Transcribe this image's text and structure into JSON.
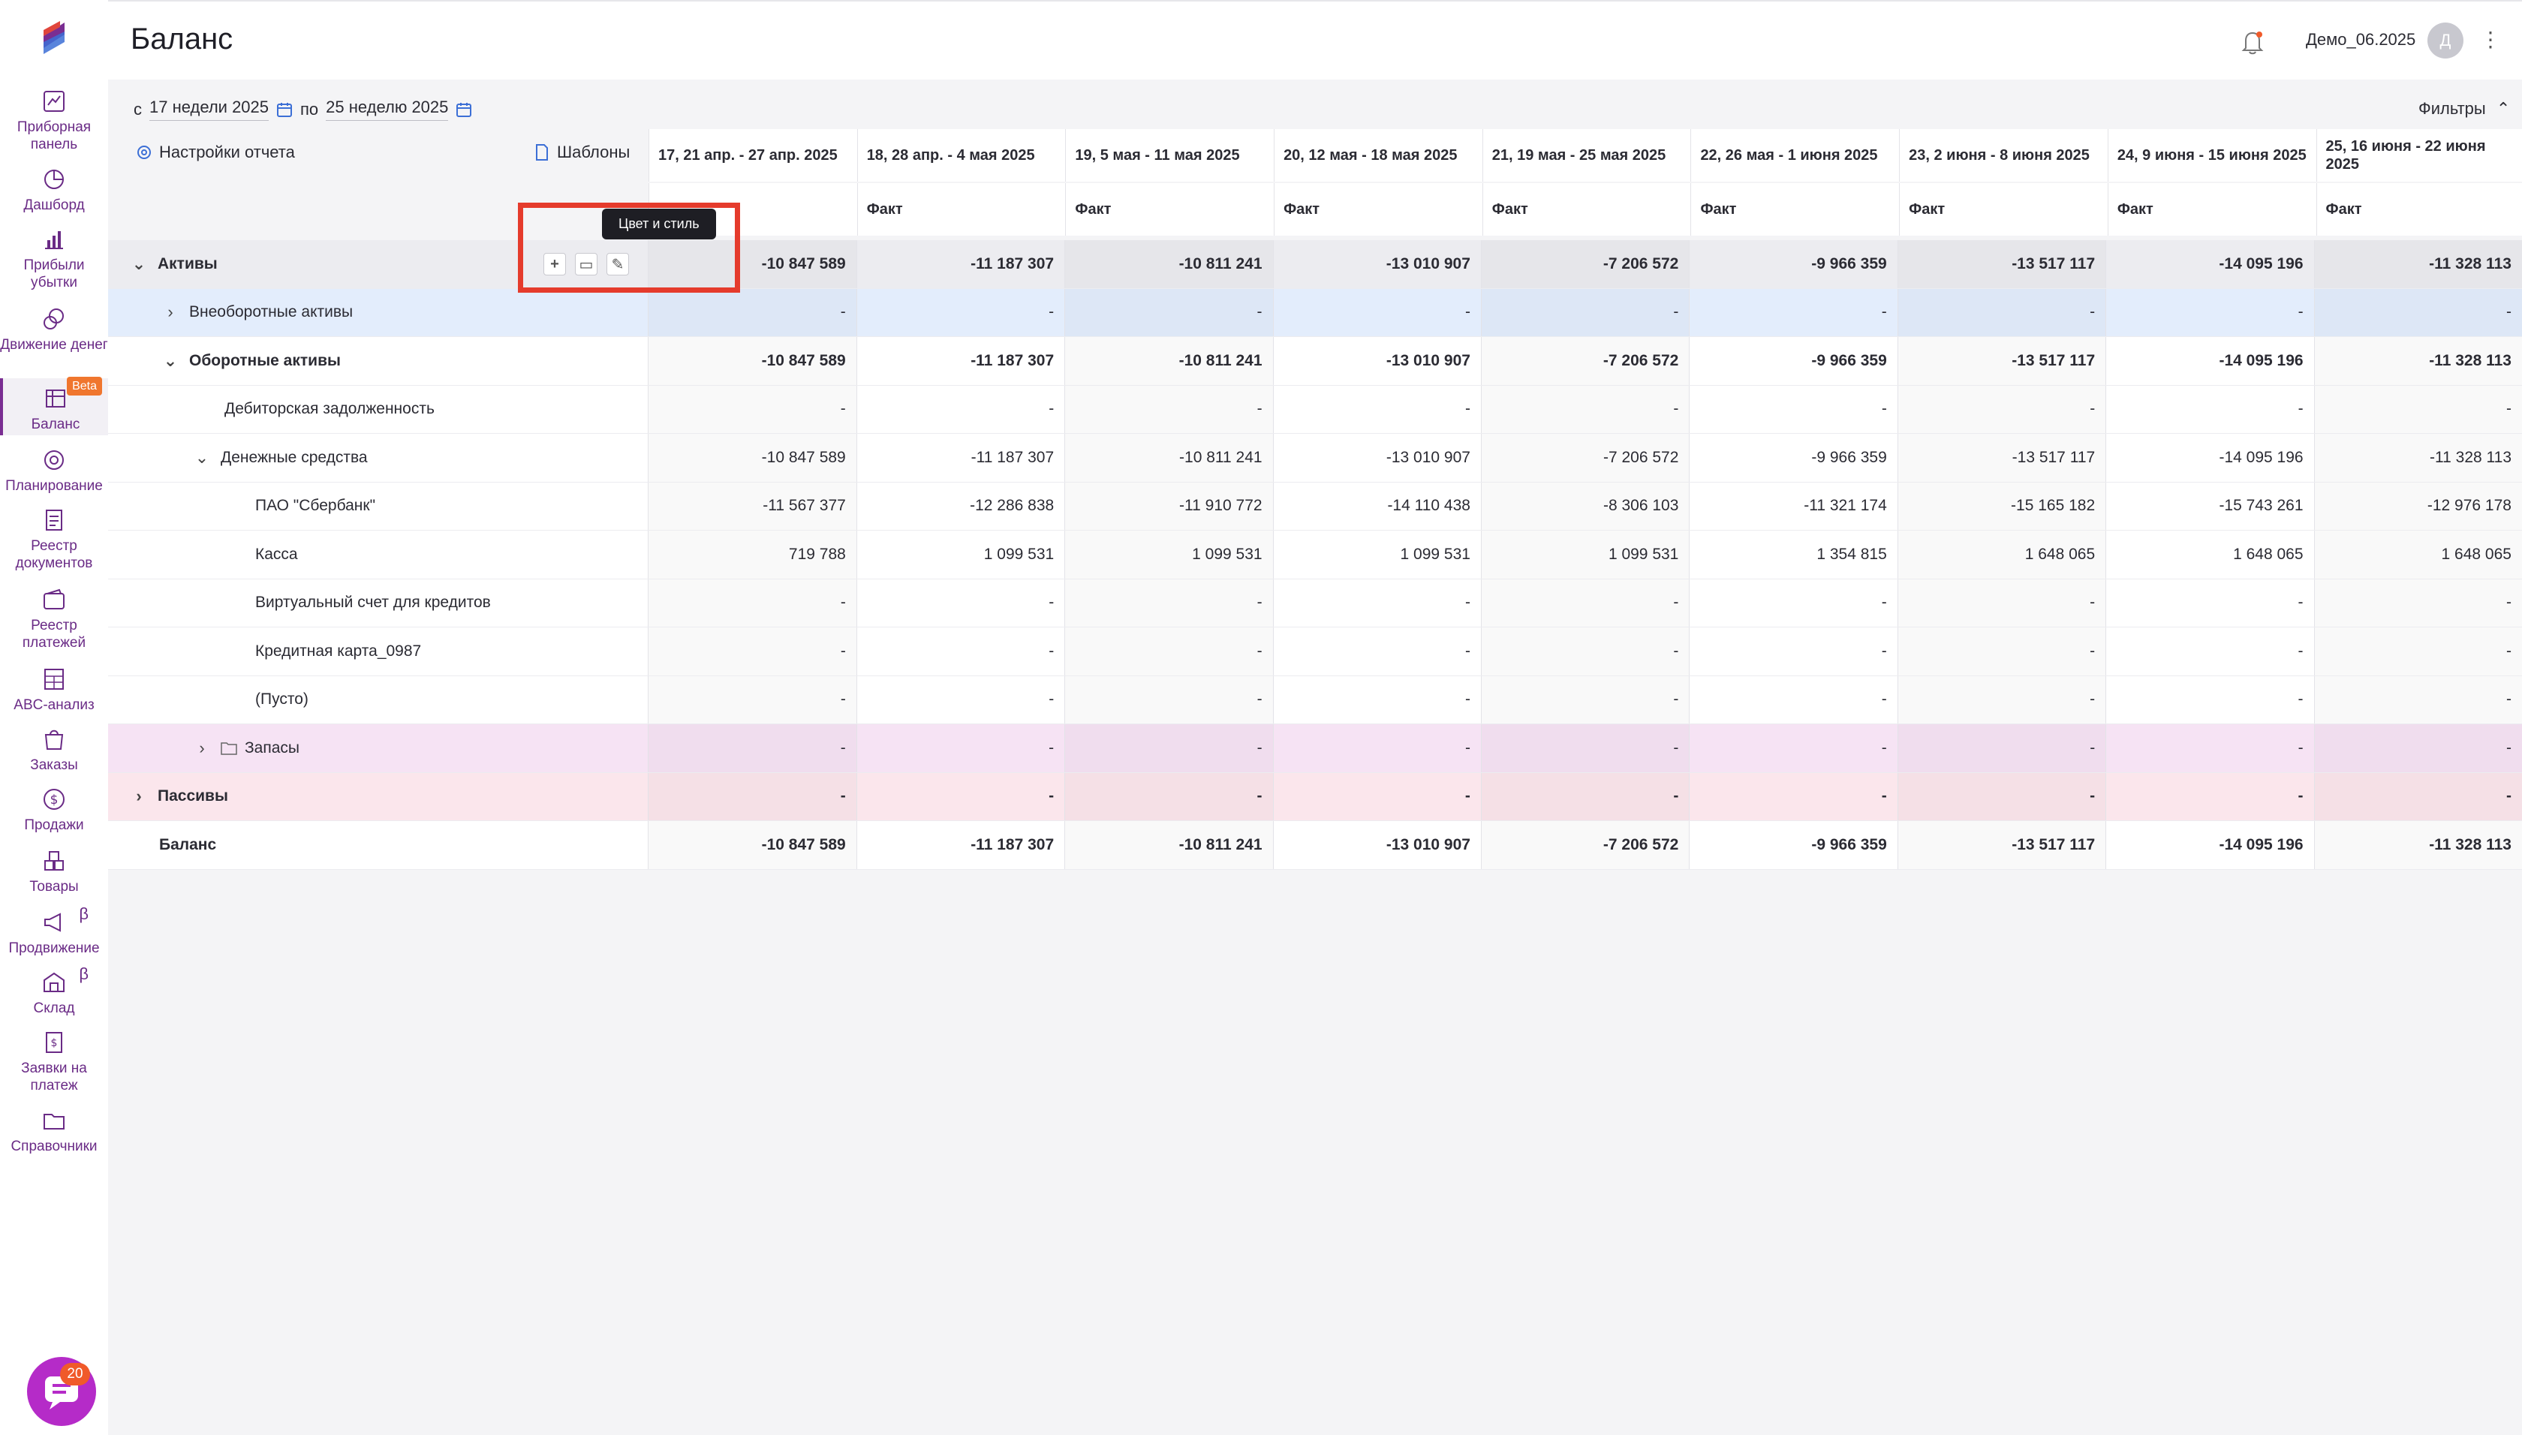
{
  "page_title": "Баланс",
  "user": {
    "name": "Демо_06.2025",
    "avatar_initial": "Д"
  },
  "sidebar": {
    "items": [
      {
        "label": "Приборная панель",
        "icon": "gauge-icon"
      },
      {
        "label": "Дашборд",
        "icon": "pie-chart-icon"
      },
      {
        "label": "Прибыли убытки",
        "icon": "bar-chart-icon"
      },
      {
        "label": "Движение денег",
        "icon": "coins-icon"
      },
      {
        "label": "Баланс",
        "icon": "balance-icon",
        "badge": "Beta"
      },
      {
        "label": "Планирование",
        "icon": "target-icon"
      },
      {
        "label": "Реестр документов",
        "icon": "documents-icon"
      },
      {
        "label": "Реестр платежей",
        "icon": "wallet-icon"
      },
      {
        "label": "ABC-анализ",
        "icon": "abc-icon"
      },
      {
        "label": "Заказы",
        "icon": "shopping-bag-icon"
      },
      {
        "label": "Продажи",
        "icon": "dollar-circle-icon"
      },
      {
        "label": "Товары",
        "icon": "boxes-icon"
      },
      {
        "label": "Продвижение",
        "icon": "megaphone-icon",
        "sup": "β"
      },
      {
        "label": "Склад",
        "icon": "warehouse-icon",
        "sup": "β"
      },
      {
        "label": "Заявки на платеж",
        "icon": "invoice-icon"
      },
      {
        "label": "Справочники",
        "icon": "folder-icon"
      }
    ],
    "chat_count": "20"
  },
  "filters": {
    "from_prefix": "с",
    "from_value": "17 недели 2025",
    "to_prefix": "по",
    "to_value": "25 неделю 2025",
    "filters_label": "Фильтры",
    "settings_label": "Настройки отчета",
    "templates_label": "Шаблоны"
  },
  "columns": [
    {
      "label": "17, 21 апр. - 27 апр. 2025",
      "sub": ""
    },
    {
      "label": "18, 28 апр. - 4 мая 2025",
      "sub": "Факт"
    },
    {
      "label": "19, 5 мая - 11 мая 2025",
      "sub": "Факт"
    },
    {
      "label": "20, 12 мая - 18 мая 2025",
      "sub": "Факт"
    },
    {
      "label": "21, 19 мая - 25 мая 2025",
      "sub": "Факт"
    },
    {
      "label": "22, 26 мая - 1 июня 2025",
      "sub": "Факт"
    },
    {
      "label": "23, 2 июня - 8 июня 2025",
      "sub": "Факт"
    },
    {
      "label": "24, 9 июня - 15 июня 2025",
      "sub": "Факт"
    },
    {
      "label": "25, 16 июня - 22 июня 2025",
      "sub": "Факт"
    }
  ],
  "rows": [
    {
      "name": "Активы",
      "chevron": "down",
      "values": [
        "-10 847 589",
        "-11 187 307",
        "-10 811 241",
        "-13 010 907",
        "-7 206 572",
        "-9 966 359",
        "-13 517 117",
        "-14 095 196",
        "-11 328 113"
      ]
    },
    {
      "name": "Внеоборотные активы",
      "chevron": "right",
      "values": [
        "-",
        "-",
        "-",
        "-",
        "-",
        "-",
        "-",
        "-",
        "-"
      ]
    },
    {
      "name": "Оборотные активы",
      "chevron": "down",
      "values": [
        "-10 847 589",
        "-11 187 307",
        "-10 811 241",
        "-13 010 907",
        "-7 206 572",
        "-9 966 359",
        "-13 517 117",
        "-14 095 196",
        "-11 328 113"
      ]
    },
    {
      "name": "Дебиторская задолженность",
      "chevron": "",
      "values": [
        "-",
        "-",
        "-",
        "-",
        "-",
        "-",
        "-",
        "-",
        "-"
      ]
    },
    {
      "name": "Денежные средства",
      "chevron": "down",
      "values": [
        "-10 847 589",
        "-11 187 307",
        "-10 811 241",
        "-13 010 907",
        "-7 206 572",
        "-9 966 359",
        "-13 517 117",
        "-14 095 196",
        "-11 328 113"
      ]
    },
    {
      "name": "ПАО \"Сбербанк\"",
      "chevron": "",
      "values": [
        "-11 567 377",
        "-12 286 838",
        "-11 910 772",
        "-14 110 438",
        "-8 306 103",
        "-11 321 174",
        "-15 165 182",
        "-15 743 261",
        "-12 976 178"
      ]
    },
    {
      "name": "Касса",
      "chevron": "",
      "values": [
        "719 788",
        "1 099 531",
        "1 099 531",
        "1 099 531",
        "1 099 531",
        "1 354 815",
        "1 648 065",
        "1 648 065",
        "1 648 065"
      ]
    },
    {
      "name": "Виртуальный счет для кредитов",
      "chevron": "",
      "values": [
        "-",
        "-",
        "-",
        "-",
        "-",
        "-",
        "-",
        "-",
        "-"
      ]
    },
    {
      "name": "Кредитная карта_0987",
      "chevron": "",
      "values": [
        "-",
        "-",
        "-",
        "-",
        "-",
        "-",
        "-",
        "-",
        "-"
      ]
    },
    {
      "name": "(Пусто)",
      "chevron": "",
      "values": [
        "-",
        "-",
        "-",
        "-",
        "-",
        "-",
        "-",
        "-",
        "-"
      ]
    },
    {
      "name": "Запасы",
      "chevron": "right",
      "folder": true,
      "values": [
        "-",
        "-",
        "-",
        "-",
        "-",
        "-",
        "-",
        "-",
        "-"
      ]
    },
    {
      "name": "Пассивы",
      "chevron": "right",
      "values": [
        "-",
        "-",
        "-",
        "-",
        "-",
        "-",
        "-",
        "-",
        "-"
      ]
    },
    {
      "name": "Баланс",
      "chevron": "",
      "values": [
        "-10 847 589",
        "-11 187 307",
        "-10 811 241",
        "-13 010 907",
        "-7 206 572",
        "-9 966 359",
        "-13 517 117",
        "-14 095 196",
        "-11 328 113"
      ]
    }
  ],
  "tooltip": "Цвет и стиль",
  "colors": {
    "accent": "#7a2d92",
    "highlight": "#e53b2c",
    "chat": "#b52bc8"
  }
}
